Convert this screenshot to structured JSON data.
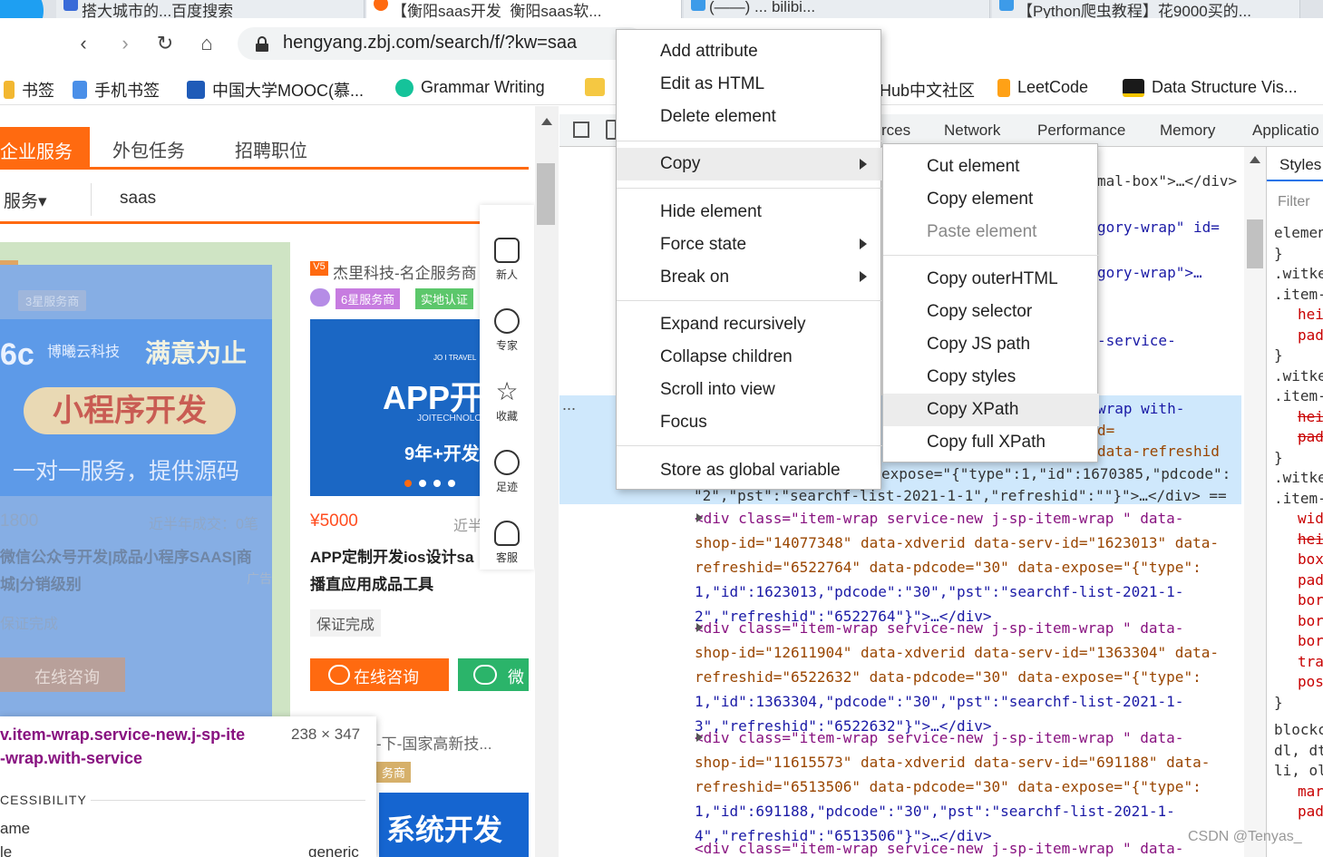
{
  "browser": {
    "tabs": [
      {
        "label": "搭大城市的...百度搜索"
      },
      {
        "label": "【衡阳saas开发_衡阳saas软..."
      },
      {
        "label": "(——) ... bilibi..."
      },
      {
        "label": "【Python爬虫教程】花9000买的..."
      }
    ],
    "url": "hengyang.zbj.com/search/f/?kw=saa",
    "bookmarks": [
      "书签",
      "手机书签",
      "中国大学MOOC(慕...",
      "Grammar Writing",
      "Hub中文社区",
      "LeetCode",
      "Data Structure Vis..."
    ]
  },
  "site": {
    "nav": [
      "企业服务",
      "外包任务",
      "招聘职位"
    ],
    "search_category": "服务▾",
    "search_query": "saas",
    "sidebar": [
      "新人",
      "专家",
      "收藏",
      "足迹",
      "客服"
    ],
    "card1": {
      "shop": "博曦云科技",
      "badge_level": "3星服务商",
      "city": "衡阳",
      "banner_brand": "博曦云科技",
      "banner_slogan": "满意为止",
      "banner_pill": "小程序开发",
      "banner_sub": "一对一服务，提供源码",
      "price": "1800",
      "deals": "近半年成交：0笔",
      "title_line1": "微信公众号开发|成品小程序SAAS|商",
      "title_line2": "城|分销级别",
      "ad": "广告",
      "guarantee": "保证完成",
      "consult": "在线咨询",
      "prefix": "游"
    },
    "card2": {
      "shop": "杰里科技-名企服务商",
      "badge_level": "6星服务商",
      "badge_cert": "实地认证",
      "banner_title": "APP开",
      "banner_sub": "9年+开发",
      "banner_brand": "JOITECHNOLO",
      "banner_small": "JO I TRAVEL",
      "price": "¥5000",
      "deals": "近半",
      "title_line1": "APP定制开发ios设计sa",
      "title_line2": "播直应用成品工具",
      "guarantee": "保证完成",
      "consult": "在线咨询",
      "wechat": "微"
    },
    "card3": {
      "shop": "-下-国家高新技...",
      "badge": "务商",
      "banner": "系统开发"
    },
    "tooltip": {
      "selector_line1": "v.item-wrap.service-new.j-sp-ite",
      "selector_line2": "-wrap.with-service",
      "size": "238 × 347",
      "section": "CESSIBILITY",
      "row1_key": "ame",
      "row2_key": "le",
      "row2_val": "generic"
    }
  },
  "devtools": {
    "tabs": [
      "rces",
      "Network",
      "Performance",
      "Memory",
      "Applicatio"
    ],
    "styles_tab": "Styles",
    "filter_placeholder": "Filter",
    "styles_lines": [
      "elemen",
      "}",
      ".witke",
      ".item-",
      "hei",
      "pad",
      "}",
      ".witke",
      ".item-",
      "hei",
      "pad",
      "}",
      ".witke",
      ".item-",
      "wid",
      "hei",
      "box",
      "pad",
      "bor",
      "bor",
      "bor",
      "tra",
      "pos",
      "}",
      "blockc",
      "dl, dt",
      "li, ol",
      "mar",
      "pad"
    ],
    "ellipsis": "...",
    "code": {
      "l1_b": "mal-box\">…</div>",
      "l2_b": "gory-wrap\" id=",
      "l3_b": "gory-wrap\">…",
      "l4_b": "-service-",
      "l5_b": "wrap  with-",
      "l6_b": "d=",
      "l7_b": "data-refreshid",
      "l8": "expose=\"{\"type\":1,\"id\":1670385,\"pdcode\":",
      "l9": "\"2\",\"pst\":\"searchf-list-2021-1-1\",\"refreshid\":\"\"}\">…</div> ==",
      "blocks": [
        [
          "<div class=\"item-wrap service-new j-sp-item-wrap   \" data-",
          "shop-id=\"14077348\" data-xdverid data-serv-id=\"1623013\" data-",
          "refreshid=\"6522764\" data-pdcode=\"30\" data-expose=\"{\"type\":",
          "1,\"id\":1623013,\"pdcode\":\"30\",\"pst\":\"searchf-list-2021-1-",
          "2\",\"refreshid\":\"6522764\"}\">…</div>"
        ],
        [
          "<div class=\"item-wrap service-new j-sp-item-wrap   \" data-",
          "shop-id=\"12611904\" data-xdverid data-serv-id=\"1363304\" data-",
          "refreshid=\"6522632\" data-pdcode=\"30\" data-expose=\"{\"type\":",
          "1,\"id\":1363304,\"pdcode\":\"30\",\"pst\":\"searchf-list-2021-1-",
          "3\",\"refreshid\":\"6522632\"}\">…</div>"
        ],
        [
          "<div class=\"item-wrap service-new j-sp-item-wrap   \" data-",
          "shop-id=\"11615573\" data-xdverid data-serv-id=\"691188\" data-",
          "refreshid=\"6513506\" data-pdcode=\"30\" data-expose=\"{\"type\":",
          "1,\"id\":691188,\"pdcode\":\"30\",\"pst\":\"searchf-list-2021-1-",
          "4\",\"refreshid\":\"6513506\"}\">…</div>"
        ]
      ],
      "last": "<div class=\"item-wrap service-new j-sp-item-wrap   \" data-"
    }
  },
  "context_menu": {
    "items": [
      "Add attribute",
      "Edit as HTML",
      "Delete element",
      "Copy",
      "Hide element",
      "Force state",
      "Break on",
      "Expand recursively",
      "Collapse children",
      "Scroll into view",
      "Focus",
      "Store as global variable"
    ]
  },
  "copy_submenu": {
    "items": [
      "Cut element",
      "Copy element",
      "Paste element",
      "Copy outerHTML",
      "Copy selector",
      "Copy JS path",
      "Copy styles",
      "Copy XPath",
      "Copy full XPath"
    ]
  },
  "watermark": "CSDN @Tenyas_"
}
